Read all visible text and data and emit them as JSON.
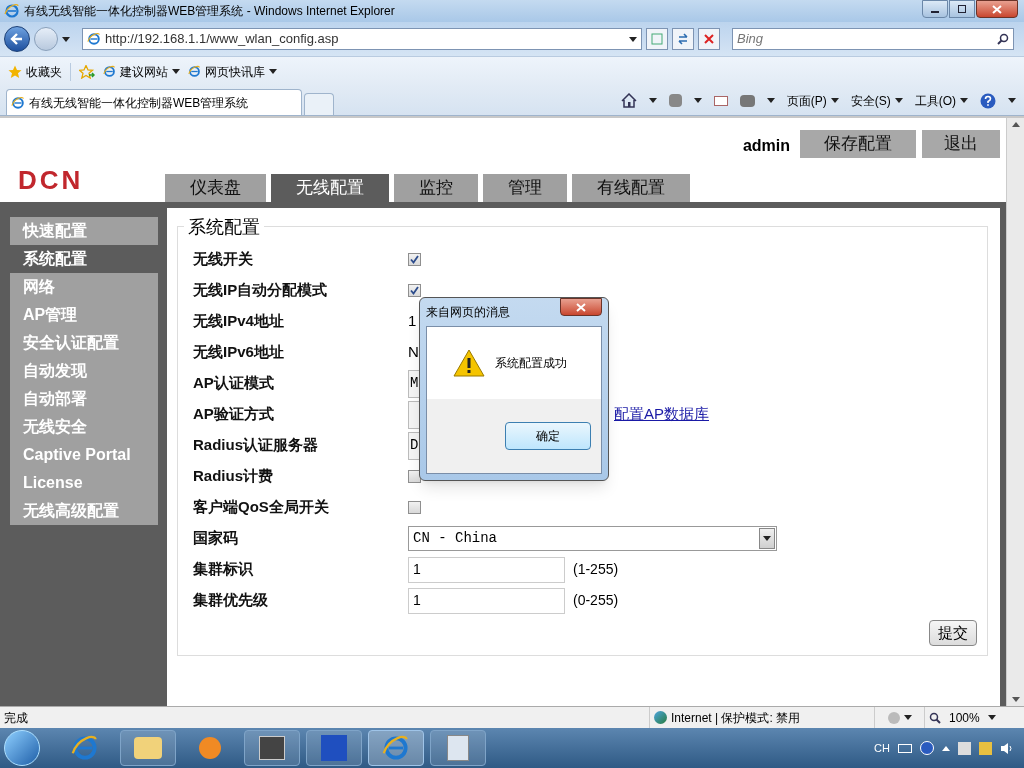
{
  "window": {
    "title": "有线无线智能一体化控制器WEB管理系统 - Windows Internet Explorer"
  },
  "address_bar": {
    "url": "http://192.168.1.1/www_wlan_config.asp"
  },
  "search": {
    "placeholder": "Bing"
  },
  "favorites_bar": {
    "label": "收藏夹",
    "items": [
      "建议网站",
      "网页快讯库"
    ]
  },
  "browser_tab": {
    "title": "有线无线智能一体化控制器WEB管理系统"
  },
  "command_bar": [
    "页面(P)",
    "安全(S)",
    "工具(O)"
  ],
  "header": {
    "logo": "DCN",
    "user": "admin",
    "buttons": [
      "保存配置",
      "退出"
    ]
  },
  "tabs": [
    {
      "label": "仪表盘",
      "selected": false
    },
    {
      "label": "无线配置",
      "selected": true
    },
    {
      "label": "监控",
      "selected": false
    },
    {
      "label": "管理",
      "selected": false
    },
    {
      "label": "有线配置",
      "selected": false
    }
  ],
  "sidebar": [
    {
      "label": "快速配置",
      "selected": false
    },
    {
      "label": "系统配置",
      "selected": true
    },
    {
      "label": "网络",
      "selected": false
    },
    {
      "label": "AP管理",
      "selected": false
    },
    {
      "label": "安全认证配置",
      "selected": false
    },
    {
      "label": "自动发现",
      "selected": false
    },
    {
      "label": "自动部署",
      "selected": false
    },
    {
      "label": "无线安全",
      "selected": false
    },
    {
      "label": "Captive Portal",
      "selected": false
    },
    {
      "label": "License",
      "selected": false
    },
    {
      "label": "无线高级配置",
      "selected": false
    }
  ],
  "section_title": "系统配置",
  "rows": [
    {
      "label": "无线开关",
      "kind": "checkbox",
      "checked": true
    },
    {
      "label": "无线IP自动分配模式",
      "kind": "checkbox",
      "checked": true
    },
    {
      "label": "无线IPv4地址",
      "kind": "text",
      "value": "1"
    },
    {
      "label": "无线IPv6地址",
      "kind": "text",
      "value": "N"
    },
    {
      "label": "AP认证模式",
      "kind": "select",
      "value": "M"
    },
    {
      "label": "AP验证方式",
      "kind": "select",
      "link": "配置AP数据库"
    },
    {
      "label": "Radius认证服务器",
      "kind": "select",
      "value": "D"
    },
    {
      "label": "Radius计费",
      "kind": "checkbox",
      "checked": false
    },
    {
      "label": "客户端QoS全局开关",
      "kind": "checkbox",
      "checked": false
    },
    {
      "label": "国家码",
      "kind": "wide-select",
      "value": "CN - China"
    },
    {
      "label": "集群标识",
      "kind": "input",
      "value": "1",
      "hint": "(1-255)"
    },
    {
      "label": "集群优先级",
      "kind": "input",
      "value": "1",
      "hint": "(0-255)"
    }
  ],
  "submit": "提交",
  "dialog": {
    "title": "来自网页的消息",
    "message": "系统配置成功",
    "button": "确定"
  },
  "status_bar": {
    "text": "完成",
    "zone": "Internet | 保护模式: 禁用",
    "zoom": "100%"
  },
  "taskbar": {
    "input_indicator": "CH"
  }
}
